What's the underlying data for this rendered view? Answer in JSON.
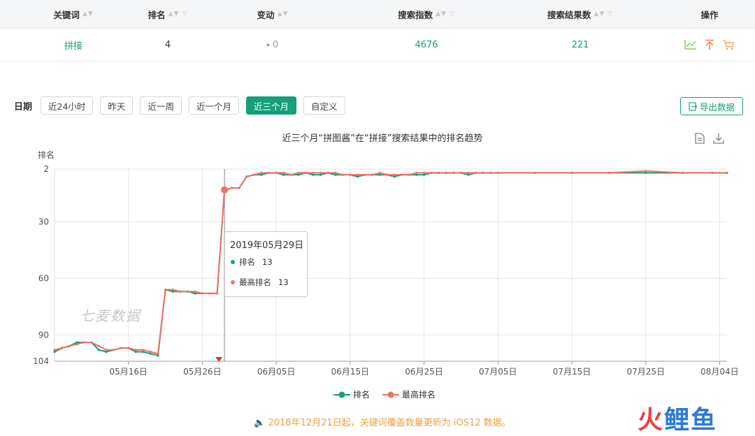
{
  "table": {
    "headers": [
      "关键词",
      "排名",
      "变动",
      "搜索指数",
      "搜索结果数",
      "操作"
    ],
    "row": {
      "keyword": "拼接",
      "rank": "4",
      "change_arrow": "▸",
      "change": "0",
      "search_index": "4676",
      "result_count": "221"
    },
    "ops_icons": [
      "trend-icon",
      "pin-top-icon",
      "cart-icon"
    ]
  },
  "datebar": {
    "label": "日期",
    "ranges": [
      "近24小时",
      "昨天",
      "近一周",
      "近一个月",
      "近三个月",
      "自定义"
    ],
    "active": "近三个月",
    "export_label": "导出数据"
  },
  "chart_title": "近三个月“拼图酱”在“拼接”搜索结果中的排名趋势",
  "watermark": "七麦数据",
  "tooltip": {
    "date": "2019年05月29日",
    "rows": [
      {
        "name": "排名",
        "value": "13"
      },
      {
        "name": "最高排名",
        "value": "13"
      }
    ]
  },
  "notice": "🔈 2018年12月21日起，关键词覆盖数量更新为 iOS12 数据。",
  "logo": [
    "火",
    "鲤",
    "鱼"
  ],
  "colors": {
    "accent": "#14a07a",
    "rank_line": "#14a07a",
    "best_line": "#ef7165",
    "notice": "#f0a040"
  },
  "chart_data": {
    "type": "line",
    "ylabel": "排名",
    "y_reversed": true,
    "ylim": [
      2,
      104
    ],
    "y_ticks": [
      2,
      30,
      60,
      90,
      104
    ],
    "x_ticks": [
      "05月16日",
      "05月26日",
      "06月05日",
      "06月15日",
      "06月25日",
      "07月05日",
      "07月15日",
      "07月25日",
      "08月04日"
    ],
    "x_range": [
      "2019-05-06",
      "2019-08-05"
    ],
    "tooltip_date": "2019-05-29",
    "legend": [
      "排名",
      "最高排名"
    ],
    "series": [
      {
        "name": "排名",
        "points": [
          [
            "2019-05-06",
            99
          ],
          [
            "2019-05-07",
            97
          ],
          [
            "2019-05-08",
            96
          ],
          [
            "2019-05-09",
            94
          ],
          [
            "2019-05-10",
            94
          ],
          [
            "2019-05-11",
            94
          ],
          [
            "2019-05-12",
            98
          ],
          [
            "2019-05-13",
            99
          ],
          [
            "2019-05-14",
            98
          ],
          [
            "2019-05-15",
            97
          ],
          [
            "2019-05-16",
            97
          ],
          [
            "2019-05-17",
            99
          ],
          [
            "2019-05-18",
            99
          ],
          [
            "2019-05-19",
            100
          ],
          [
            "2019-05-20",
            101
          ],
          [
            "2019-05-21",
            66
          ],
          [
            "2019-05-22",
            67
          ],
          [
            "2019-05-23",
            67
          ],
          [
            "2019-05-24",
            67
          ],
          [
            "2019-05-25",
            68
          ],
          [
            "2019-05-26",
            68
          ],
          [
            "2019-05-27",
            68
          ],
          [
            "2019-05-28",
            68
          ],
          [
            "2019-05-29",
            13
          ],
          [
            "2019-05-30",
            12
          ],
          [
            "2019-05-31",
            12
          ],
          [
            "2019-06-01",
            6
          ],
          [
            "2019-06-02",
            5
          ],
          [
            "2019-06-03",
            5
          ],
          [
            "2019-06-04",
            4
          ],
          [
            "2019-06-05",
            4
          ],
          [
            "2019-06-06",
            5
          ],
          [
            "2019-06-07",
            5
          ],
          [
            "2019-06-08",
            5
          ],
          [
            "2019-06-09",
            4
          ],
          [
            "2019-06-10",
            5
          ],
          [
            "2019-06-11",
            5
          ],
          [
            "2019-06-12",
            4
          ],
          [
            "2019-06-13",
            5
          ],
          [
            "2019-06-14",
            5
          ],
          [
            "2019-06-15",
            5
          ],
          [
            "2019-06-16",
            6
          ],
          [
            "2019-06-17",
            5
          ],
          [
            "2019-06-18",
            5
          ],
          [
            "2019-06-19",
            5
          ],
          [
            "2019-06-20",
            5
          ],
          [
            "2019-06-21",
            6
          ],
          [
            "2019-06-22",
            5
          ],
          [
            "2019-06-23",
            5
          ],
          [
            "2019-06-24",
            5
          ],
          [
            "2019-06-25",
            5
          ],
          [
            "2019-06-26",
            4
          ],
          [
            "2019-06-27",
            4
          ],
          [
            "2019-06-28",
            4
          ],
          [
            "2019-06-29",
            4
          ],
          [
            "2019-06-30",
            4
          ],
          [
            "2019-07-01",
            5
          ],
          [
            "2019-07-02",
            4
          ],
          [
            "2019-07-03",
            4
          ],
          [
            "2019-07-04",
            4
          ],
          [
            "2019-07-05",
            4
          ],
          [
            "2019-07-10",
            4
          ],
          [
            "2019-07-15",
            4
          ],
          [
            "2019-07-20",
            4
          ],
          [
            "2019-07-25",
            4
          ],
          [
            "2019-07-30",
            4
          ],
          [
            "2019-08-03",
            4
          ],
          [
            "2019-08-05",
            4
          ]
        ]
      },
      {
        "name": "最高排名",
        "points": [
          [
            "2019-05-06",
            98
          ],
          [
            "2019-05-07",
            97
          ],
          [
            "2019-05-08",
            96
          ],
          [
            "2019-05-09",
            95
          ],
          [
            "2019-05-10",
            94
          ],
          [
            "2019-05-11",
            94
          ],
          [
            "2019-05-12",
            96
          ],
          [
            "2019-05-13",
            98
          ],
          [
            "2019-05-14",
            98
          ],
          [
            "2019-05-15",
            97
          ],
          [
            "2019-05-16",
            97
          ],
          [
            "2019-05-17",
            98
          ],
          [
            "2019-05-18",
            98
          ],
          [
            "2019-05-19",
            99
          ],
          [
            "2019-05-20",
            100
          ],
          [
            "2019-05-21",
            66
          ],
          [
            "2019-05-22",
            66
          ],
          [
            "2019-05-23",
            67
          ],
          [
            "2019-05-24",
            67
          ],
          [
            "2019-05-25",
            67
          ],
          [
            "2019-05-26",
            68
          ],
          [
            "2019-05-27",
            68
          ],
          [
            "2019-05-28",
            68
          ],
          [
            "2019-05-29",
            13
          ],
          [
            "2019-05-30",
            12
          ],
          [
            "2019-05-31",
            12
          ],
          [
            "2019-06-01",
            6
          ],
          [
            "2019-06-02",
            5
          ],
          [
            "2019-06-03",
            4
          ],
          [
            "2019-06-04",
            4
          ],
          [
            "2019-06-05",
            4
          ],
          [
            "2019-06-06",
            4
          ],
          [
            "2019-06-07",
            5
          ],
          [
            "2019-06-08",
            4
          ],
          [
            "2019-06-09",
            4
          ],
          [
            "2019-06-10",
            4
          ],
          [
            "2019-06-11",
            4
          ],
          [
            "2019-06-12",
            4
          ],
          [
            "2019-06-13",
            4
          ],
          [
            "2019-06-14",
            5
          ],
          [
            "2019-06-15",
            5
          ],
          [
            "2019-06-16",
            5
          ],
          [
            "2019-06-17",
            5
          ],
          [
            "2019-06-18",
            5
          ],
          [
            "2019-06-19",
            4
          ],
          [
            "2019-06-20",
            5
          ],
          [
            "2019-06-21",
            5
          ],
          [
            "2019-06-22",
            5
          ],
          [
            "2019-06-23",
            5
          ],
          [
            "2019-06-24",
            4
          ],
          [
            "2019-06-25",
            4
          ],
          [
            "2019-06-26",
            4
          ],
          [
            "2019-06-27",
            4
          ],
          [
            "2019-06-28",
            4
          ],
          [
            "2019-06-29",
            4
          ],
          [
            "2019-06-30",
            4
          ],
          [
            "2019-07-01",
            4
          ],
          [
            "2019-07-02",
            4
          ],
          [
            "2019-07-03",
            4
          ],
          [
            "2019-07-04",
            4
          ],
          [
            "2019-07-05",
            4
          ],
          [
            "2019-07-10",
            4
          ],
          [
            "2019-07-15",
            4
          ],
          [
            "2019-07-20",
            4
          ],
          [
            "2019-07-25",
            3
          ],
          [
            "2019-07-30",
            4
          ],
          [
            "2019-08-03",
            4
          ],
          [
            "2019-08-05",
            4
          ]
        ]
      }
    ]
  }
}
